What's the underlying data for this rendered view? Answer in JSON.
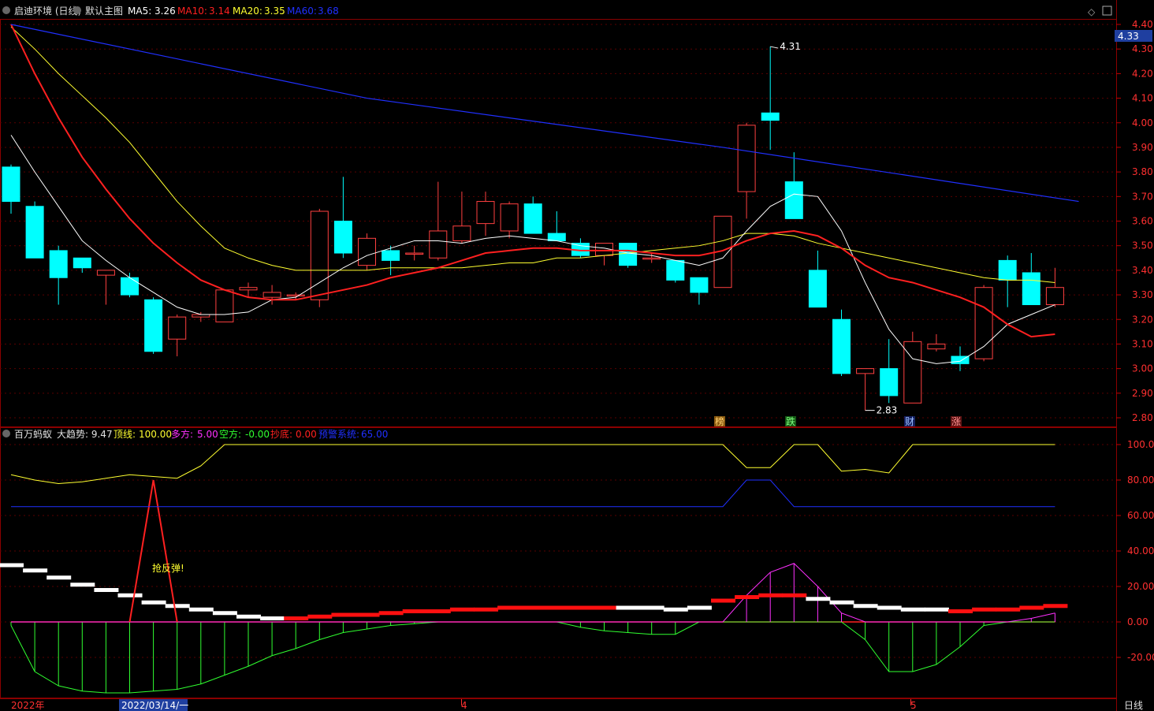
{
  "header": {
    "stock": "启迪环境 (日线)",
    "main_view": "默认主图",
    "ma5": {
      "label": "MA5:",
      "value": "3.26",
      "color": "#ffffff"
    },
    "ma10": {
      "label": "MA10:",
      "value": "3.14",
      "color": "#ff2020"
    },
    "ma20": {
      "label": "MA20:",
      "value": "3.35",
      "color": "#ffff30"
    },
    "ma60": {
      "label": "MA60:",
      "value": "3.68",
      "color": "#2030ff"
    }
  },
  "sub_header": {
    "name": "百万蚂蚁",
    "trend": "大趋势: 9.47",
    "top": {
      "label": "顶线:",
      "value": "100.00",
      "color": "#ffff30"
    },
    "long": {
      "label": "多方:",
      "value": "5.00",
      "color": "#ff30ff"
    },
    "short": {
      "label": "空方:",
      "value": "-0.00",
      "color": "#30ff30"
    },
    "bottom": {
      "label": "抄底:",
      "value": "0.00",
      "color": "#ff2020"
    },
    "warn": {
      "label": "预警系统:",
      "value": "65.00",
      "color": "#2030ff"
    }
  },
  "price_axis": {
    "ticks": [
      "4.40",
      "4.30",
      "4.20",
      "4.10",
      "4.00",
      "3.90",
      "3.80",
      "3.70",
      "3.60",
      "3.50",
      "3.40",
      "3.30",
      "3.20",
      "3.10",
      "3.00",
      "2.90",
      "2.80"
    ],
    "current": "4.33"
  },
  "sub_axis": {
    "ticks": [
      "100.00",
      "80.00",
      "60.00",
      "40.00",
      "20.00",
      "0.00",
      "-20.00"
    ]
  },
  "date_axis": {
    "labels": [
      "2022年",
      "2022/03/14/一",
      "4",
      "5"
    ],
    "period": "日线"
  },
  "annotations": {
    "high": "4.31",
    "low": "2.83",
    "rebound": "抢反弹!",
    "markers": [
      "榜",
      "跌",
      "财",
      "涨"
    ]
  },
  "chart_data": [
    {
      "type": "candlestick",
      "ylim": [
        2.76,
        4.42
      ],
      "candles": [
        {
          "o": 3.82,
          "h": 3.83,
          "l": 3.63,
          "c": 3.68
        },
        {
          "o": 3.66,
          "h": 3.68,
          "l": 3.45,
          "c": 3.45
        },
        {
          "o": 3.48,
          "h": 3.5,
          "l": 3.26,
          "c": 3.37
        },
        {
          "o": 3.45,
          "h": 3.45,
          "l": 3.39,
          "c": 3.41
        },
        {
          "o": 3.38,
          "h": 3.4,
          "l": 3.26,
          "c": 3.4
        },
        {
          "o": 3.37,
          "h": 3.39,
          "l": 3.29,
          "c": 3.3
        },
        {
          "o": 3.28,
          "h": 3.29,
          "l": 3.06,
          "c": 3.07
        },
        {
          "o": 3.12,
          "h": 3.22,
          "l": 3.05,
          "c": 3.21
        },
        {
          "o": 3.21,
          "h": 3.23,
          "l": 3.19,
          "c": 3.22
        },
        {
          "o": 3.19,
          "h": 3.32,
          "l": 3.19,
          "c": 3.32
        },
        {
          "o": 3.32,
          "h": 3.35,
          "l": 3.29,
          "c": 3.33
        },
        {
          "o": 3.29,
          "h": 3.34,
          "l": 3.26,
          "c": 3.31
        },
        {
          "o": 3.3,
          "h": 3.31,
          "l": 3.28,
          "c": 3.3
        },
        {
          "o": 3.28,
          "h": 3.65,
          "l": 3.25,
          "c": 3.64
        },
        {
          "o": 3.6,
          "h": 3.78,
          "l": 3.45,
          "c": 3.47
        },
        {
          "o": 3.42,
          "h": 3.55,
          "l": 3.4,
          "c": 3.53
        },
        {
          "o": 3.48,
          "h": 3.5,
          "l": 3.38,
          "c": 3.44
        },
        {
          "o": 3.47,
          "h": 3.5,
          "l": 3.44,
          "c": 3.47
        },
        {
          "o": 3.45,
          "h": 3.76,
          "l": 3.44,
          "c": 3.56
        },
        {
          "o": 3.52,
          "h": 3.72,
          "l": 3.51,
          "c": 3.58
        },
        {
          "o": 3.59,
          "h": 3.72,
          "l": 3.54,
          "c": 3.68
        },
        {
          "o": 3.56,
          "h": 3.68,
          "l": 3.53,
          "c": 3.67
        },
        {
          "o": 3.67,
          "h": 3.7,
          "l": 3.55,
          "c": 3.55
        },
        {
          "o": 3.55,
          "h": 3.64,
          "l": 3.52,
          "c": 3.52
        },
        {
          "o": 3.51,
          "h": 3.53,
          "l": 3.45,
          "c": 3.46
        },
        {
          "o": 3.46,
          "h": 3.51,
          "l": 3.42,
          "c": 3.51
        },
        {
          "o": 3.51,
          "h": 3.51,
          "l": 3.41,
          "c": 3.42
        },
        {
          "o": 3.45,
          "h": 3.47,
          "l": 3.43,
          "c": 3.45
        },
        {
          "o": 3.44,
          "h": 3.44,
          "l": 3.35,
          "c": 3.36
        },
        {
          "o": 3.37,
          "h": 3.37,
          "l": 3.26,
          "c": 3.31
        },
        {
          "o": 3.33,
          "h": 3.62,
          "l": 3.33,
          "c": 3.62
        },
        {
          "o": 3.72,
          "h": 4.0,
          "l": 3.61,
          "c": 3.99
        },
        {
          "o": 4.04,
          "h": 4.31,
          "l": 3.89,
          "c": 4.01
        },
        {
          "o": 3.76,
          "h": 3.88,
          "l": 3.61,
          "c": 3.61
        },
        {
          "o": 3.4,
          "h": 3.48,
          "l": 3.25,
          "c": 3.25
        },
        {
          "o": 3.2,
          "h": 3.24,
          "l": 2.97,
          "c": 2.98
        },
        {
          "o": 2.98,
          "h": 3.0,
          "l": 2.83,
          "c": 3.0
        },
        {
          "o": 3.0,
          "h": 3.12,
          "l": 2.86,
          "c": 2.89
        },
        {
          "o": 2.86,
          "h": 3.15,
          "l": 2.86,
          "c": 3.11
        },
        {
          "o": 3.08,
          "h": 3.14,
          "l": 3.07,
          "c": 3.1
        },
        {
          "o": 3.05,
          "h": 3.09,
          "l": 2.99,
          "c": 3.02
        },
        {
          "o": 3.04,
          "h": 3.34,
          "l": 3.03,
          "c": 3.33
        },
        {
          "o": 3.44,
          "h": 3.46,
          "l": 3.25,
          "c": 3.36
        },
        {
          "o": 3.39,
          "h": 3.47,
          "l": 3.26,
          "c": 3.26
        },
        {
          "o": 3.26,
          "h": 3.41,
          "l": 3.25,
          "c": 3.33
        }
      ],
      "ma5": [
        3.95,
        3.8,
        3.66,
        3.52,
        3.44,
        3.37,
        3.31,
        3.25,
        3.22,
        3.22,
        3.23,
        3.28,
        3.29,
        3.35,
        3.41,
        3.46,
        3.49,
        3.52,
        3.52,
        3.51,
        3.53,
        3.54,
        3.53,
        3.52,
        3.5,
        3.49,
        3.47,
        3.46,
        3.44,
        3.42,
        3.45,
        3.56,
        3.66,
        3.71,
        3.7,
        3.56,
        3.35,
        3.16,
        3.04,
        3.02,
        3.03,
        3.09,
        3.18,
        3.22,
        3.26
      ],
      "ma10": [
        4.4,
        4.2,
        4.02,
        3.86,
        3.73,
        3.61,
        3.51,
        3.43,
        3.36,
        3.32,
        3.29,
        3.28,
        3.28,
        3.3,
        3.32,
        3.34,
        3.37,
        3.39,
        3.41,
        3.44,
        3.47,
        3.48,
        3.49,
        3.49,
        3.48,
        3.48,
        3.48,
        3.47,
        3.46,
        3.46,
        3.48,
        3.52,
        3.55,
        3.56,
        3.54,
        3.49,
        3.42,
        3.37,
        3.35,
        3.32,
        3.29,
        3.25,
        3.18,
        3.13,
        3.14
      ],
      "ma20": [
        4.39,
        4.3,
        4.2,
        4.11,
        4.02,
        3.92,
        3.8,
        3.68,
        3.58,
        3.49,
        3.45,
        3.42,
        3.4,
        3.4,
        3.4,
        3.4,
        3.41,
        3.41,
        3.41,
        3.41,
        3.42,
        3.43,
        3.43,
        3.45,
        3.45,
        3.46,
        3.47,
        3.48,
        3.49,
        3.5,
        3.52,
        3.55,
        3.55,
        3.54,
        3.51,
        3.49,
        3.47,
        3.45,
        3.43,
        3.41,
        3.39,
        3.37,
        3.36,
        3.36,
        3.35
      ],
      "ma60": [
        [
          0,
          4.4
        ],
        [
          15,
          4.1
        ],
        [
          30,
          3.9
        ],
        [
          45,
          3.68
        ]
      ]
    },
    {
      "type": "indicator",
      "ylim": [
        -43,
        110
      ],
      "top_line": [
        83,
        80,
        78,
        79,
        81,
        83,
        82,
        81,
        88,
        100,
        100,
        100,
        100,
        100,
        100,
        100,
        100,
        100,
        100,
        100,
        100,
        100,
        100,
        100,
        100,
        100,
        100,
        100,
        100,
        100,
        100,
        87,
        87,
        100,
        100,
        85,
        86,
        84,
        100,
        100,
        100,
        100,
        100,
        100,
        100
      ],
      "warn_line": [
        65,
        65,
        65,
        65,
        65,
        65,
        65,
        65,
        65,
        65,
        65,
        65,
        65,
        65,
        65,
        65,
        65,
        65,
        65,
        65,
        65,
        65,
        65,
        65,
        65,
        65,
        65,
        65,
        65,
        65,
        65,
        80,
        80,
        65,
        65,
        65,
        65,
        65,
        65,
        65,
        65,
        65,
        65,
        65,
        65
      ],
      "bottom_spike": {
        "index": 6,
        "value": 80
      },
      "short_hist": [
        -2,
        -28,
        -36,
        -39,
        -40,
        -40,
        -39,
        -38,
        -35,
        -30,
        -25,
        -19,
        -15,
        -10,
        -6,
        -4,
        -2,
        -1,
        0,
        0,
        0,
        0,
        0,
        0,
        -3,
        -5,
        -6,
        -7,
        -7,
        0,
        0,
        0,
        0,
        0,
        0,
        0,
        -10,
        -28,
        -28,
        -24,
        -14,
        -2,
        0,
        0,
        0
      ],
      "long_hist": [
        0,
        0,
        0,
        0,
        0,
        0,
        0,
        0,
        0,
        0,
        0,
        0,
        0,
        0,
        0,
        0,
        0,
        0,
        0,
        0,
        0,
        0,
        0,
        0,
        0,
        0,
        0,
        0,
        0,
        0,
        0,
        15,
        28,
        33,
        20,
        5,
        0,
        0,
        0,
        0,
        0,
        0,
        0,
        2,
        5
      ],
      "trend_bars": [
        {
          "v": 32,
          "c": "w"
        },
        {
          "v": 29,
          "c": "w"
        },
        {
          "v": 25,
          "c": "w"
        },
        {
          "v": 21,
          "c": "w"
        },
        {
          "v": 18,
          "c": "w"
        },
        {
          "v": 15,
          "c": "w"
        },
        {
          "v": 11,
          "c": "w"
        },
        {
          "v": 9,
          "c": "w"
        },
        {
          "v": 7,
          "c": "w"
        },
        {
          "v": 5,
          "c": "w"
        },
        {
          "v": 3,
          "c": "w"
        },
        {
          "v": 2,
          "c": "w"
        },
        {
          "v": 2,
          "c": "r"
        },
        {
          "v": 3,
          "c": "r"
        },
        {
          "v": 4,
          "c": "r"
        },
        {
          "v": 4,
          "c": "r"
        },
        {
          "v": 5,
          "c": "r"
        },
        {
          "v": 6,
          "c": "r"
        },
        {
          "v": 6,
          "c": "r"
        },
        {
          "v": 7,
          "c": "r"
        },
        {
          "v": 7,
          "c": "r"
        },
        {
          "v": 8,
          "c": "r"
        },
        {
          "v": 8,
          "c": "r"
        },
        {
          "v": 8,
          "c": "r"
        },
        {
          "v": 8,
          "c": "r"
        },
        {
          "v": 8,
          "c": "r"
        },
        {
          "v": 8,
          "c": "w"
        },
        {
          "v": 8,
          "c": "w"
        },
        {
          "v": 7,
          "c": "w"
        },
        {
          "v": 8,
          "c": "w"
        },
        {
          "v": 12,
          "c": "r"
        },
        {
          "v": 14,
          "c": "r"
        },
        {
          "v": 15,
          "c": "r"
        },
        {
          "v": 15,
          "c": "r"
        },
        {
          "v": 13,
          "c": "w"
        },
        {
          "v": 11,
          "c": "w"
        },
        {
          "v": 9,
          "c": "w"
        },
        {
          "v": 8,
          "c": "w"
        },
        {
          "v": 7,
          "c": "w"
        },
        {
          "v": 7,
          "c": "w"
        },
        {
          "v": 6,
          "c": "r"
        },
        {
          "v": 7,
          "c": "r"
        },
        {
          "v": 7,
          "c": "r"
        },
        {
          "v": 8,
          "c": "r"
        },
        {
          "v": 9,
          "c": "r"
        }
      ]
    }
  ]
}
